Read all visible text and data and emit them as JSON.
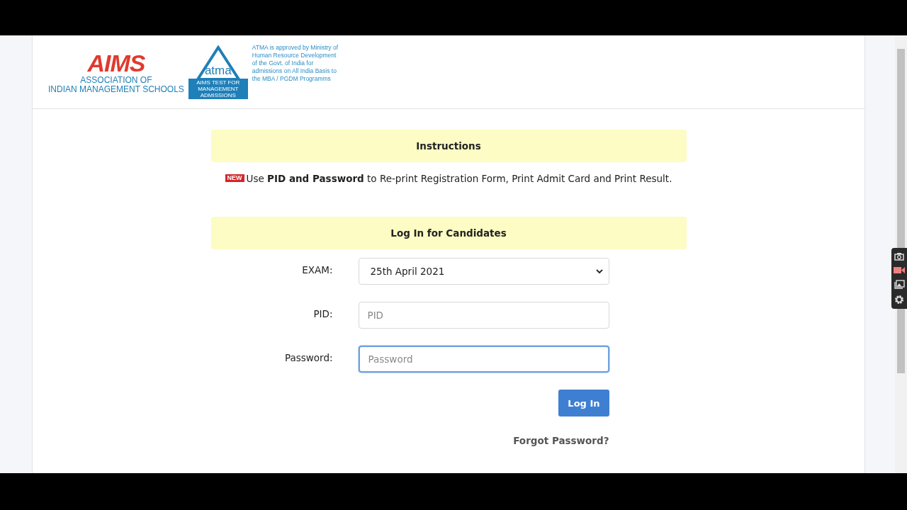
{
  "logo": {
    "aims_wordmark": "AIMS",
    "aims_line_1": "ASSOCIATION OF",
    "aims_line_2": "INDIAN MANAGEMENT SCHOOLS",
    "atma_wordmark": "atma",
    "atma_tagline": "AIMS TEST FOR MANAGEMENT ADMISSIONS",
    "approval_note": "ATMA is approved by Ministry of Human Resource Development of the Govt. of India for admissions on All India Basis to the MBA / PGDM Programms"
  },
  "instructions": {
    "title": "Instructions",
    "badge": "NEW",
    "text": "Use **PID and Password** to Re-print Registration Form, Print Admit Card and Print Result."
  },
  "login": {
    "title": "Log In for Candidates",
    "fields": [
      {
        "kind": "select",
        "label": "EXAM:",
        "value": "25th April 2021",
        "focused": false
      },
      {
        "kind": "text",
        "label": "PID:",
        "placeholder": "PID",
        "focused": false
      },
      {
        "kind": "password",
        "label": "Password:",
        "placeholder": "Password",
        "focused": true
      }
    ],
    "button": "Log In",
    "forgot_link": "Forgot Password?"
  }
}
